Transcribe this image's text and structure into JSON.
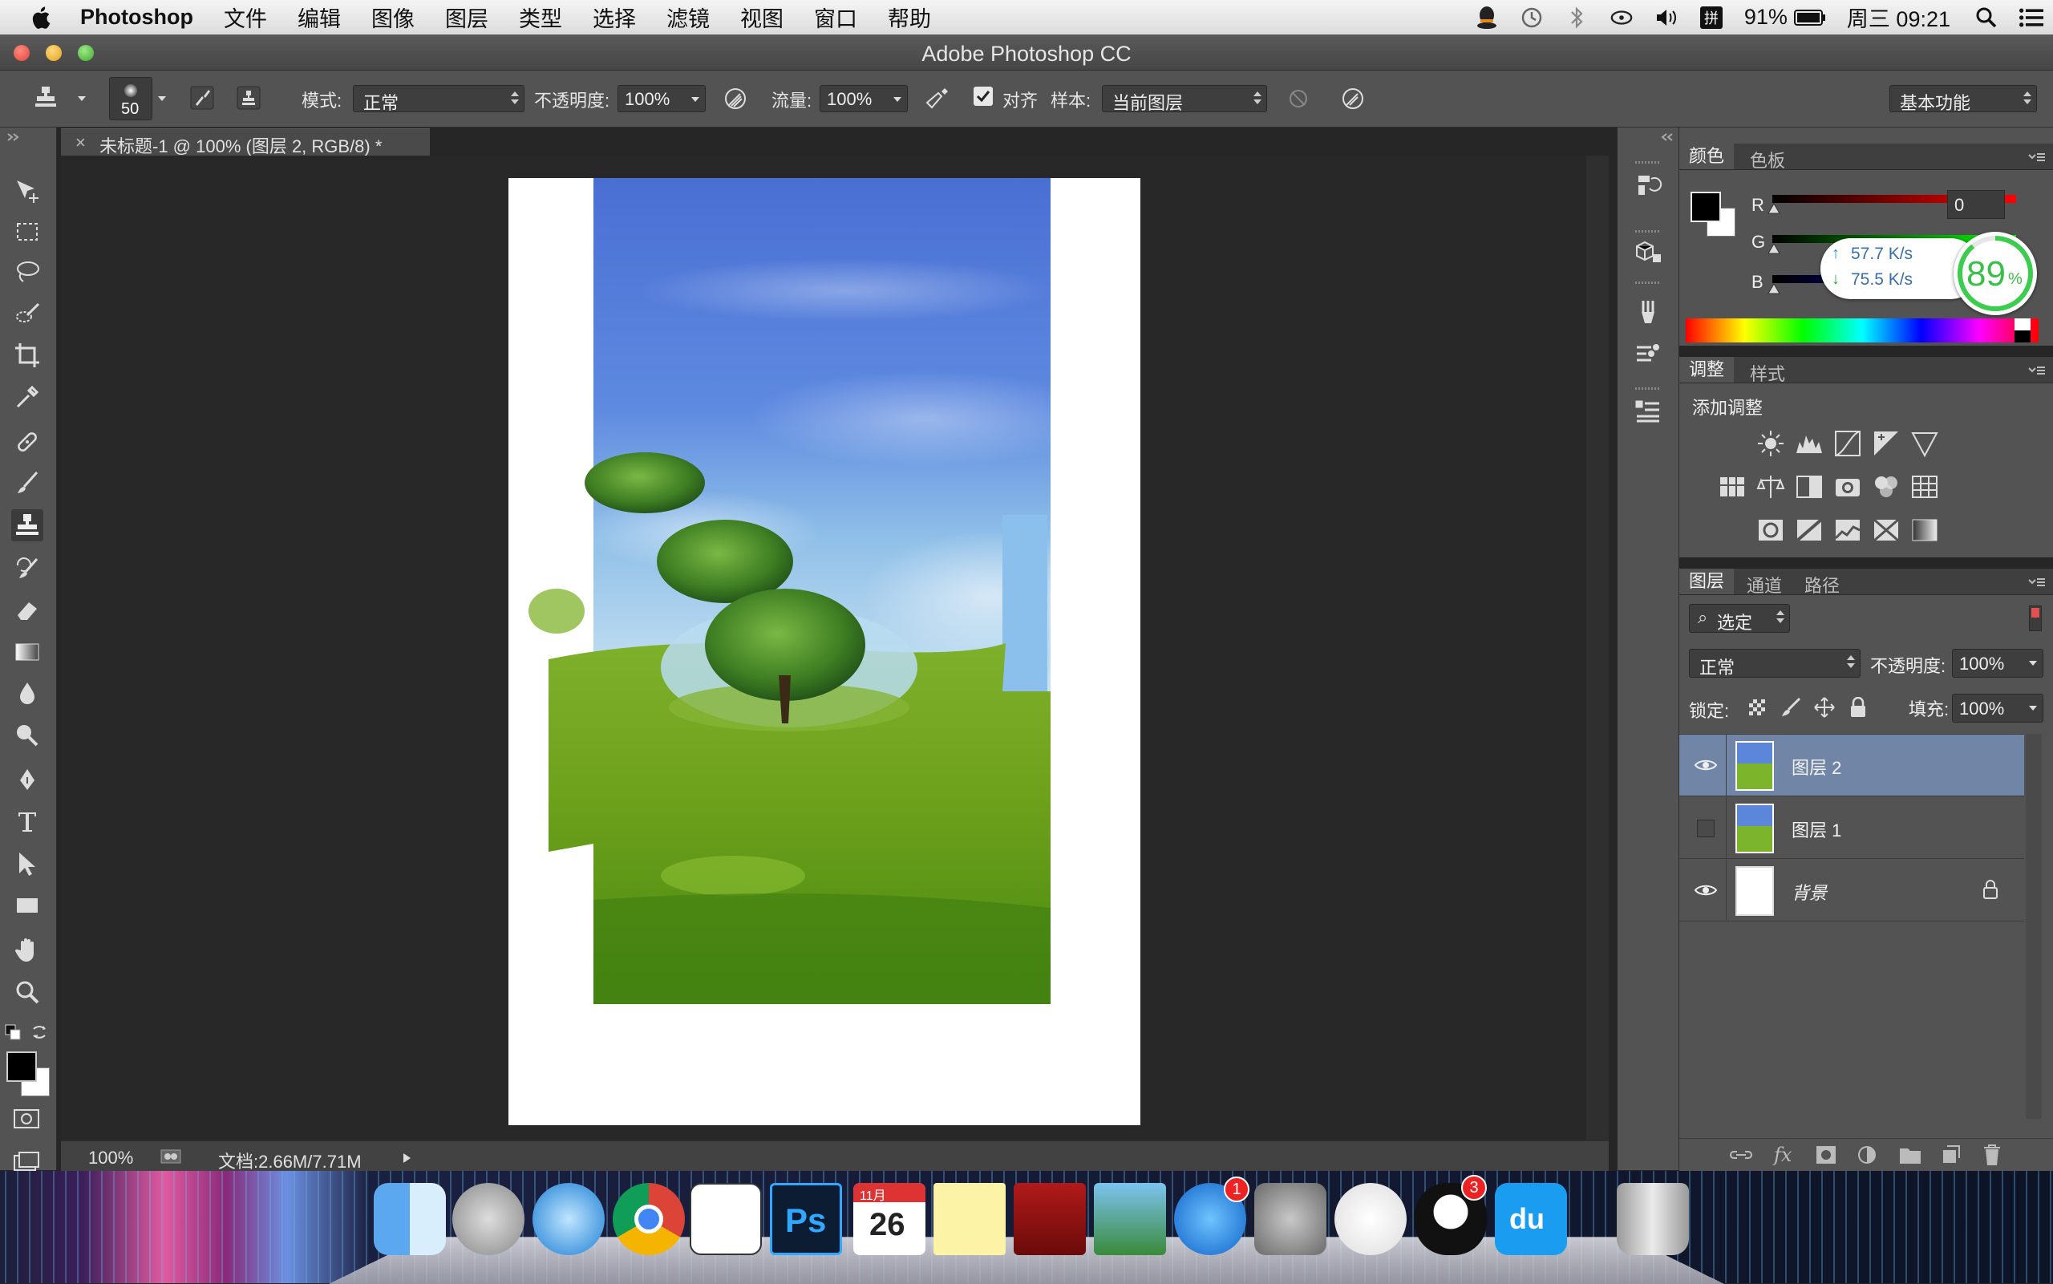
{
  "menubar": {
    "app_name": "Photoshop",
    "items": [
      "文件",
      "编辑",
      "图像",
      "图层",
      "类型",
      "选择",
      "滤镜",
      "视图",
      "窗口",
      "帮助"
    ],
    "battery": "91%",
    "clock": "周三 09:21"
  },
  "window": {
    "title": "Adobe Photoshop CC"
  },
  "options": {
    "brush_size": "50",
    "mode_label": "模式:",
    "mode_value": "正常",
    "opacity_label": "不透明度:",
    "opacity_value": "100%",
    "flow_label": "流量:",
    "flow_value": "100%",
    "align_label": "对齐",
    "align_checked": true,
    "sample_label": "样本:",
    "sample_value": "当前图层",
    "workspace": "基本功能"
  },
  "document": {
    "tab_title": "未标题-1 @ 100% (图层 2, RGB/8) *",
    "zoom": "100%",
    "doc_info": "文档:2.66M/7.71M"
  },
  "color_panel": {
    "tabs": [
      "颜色",
      "色板"
    ],
    "r_label": "R",
    "g_label": "G",
    "b_label": "B",
    "r_value": "0",
    "net_up": "57.7 K/s",
    "net_down": "75.5 K/s",
    "net_percent": "89",
    "percent_sign": "%"
  },
  "adjust_panel": {
    "tabs": [
      "调整",
      "样式"
    ],
    "heading": "添加调整"
  },
  "layers_panel": {
    "tabs": [
      "图层",
      "通道",
      "路径"
    ],
    "filter": "选定",
    "blend_mode": "正常",
    "opacity_label": "不透明度:",
    "opacity_value": "100%",
    "lock_label": "锁定:",
    "fill_label": "填充:",
    "fill_value": "100%",
    "layers": [
      {
        "name": "图层 2",
        "visible": true,
        "selected": true
      },
      {
        "name": "图层 1",
        "visible": false,
        "selected": false
      },
      {
        "name": "背景",
        "visible": true,
        "selected": false,
        "locked": true
      }
    ]
  },
  "dock": {
    "apps": [
      "finder-icon",
      "launchpad-icon",
      "safari-icon",
      "chrome-icon",
      "clock-icon",
      "photoshop-icon",
      "calendar-icon",
      "notes-icon",
      "photo-booth-icon",
      "iphoto-icon",
      "app-store-icon",
      "system-preferences-icon",
      "pinyin-icon",
      "qq-icon",
      "baidu-cloud-icon",
      "trash-icon"
    ],
    "ps_label": "Ps",
    "calendar_day": "26",
    "calendar_month": "11月",
    "appstore_badge": "1",
    "qq_badge": "3",
    "du_label": "du"
  }
}
